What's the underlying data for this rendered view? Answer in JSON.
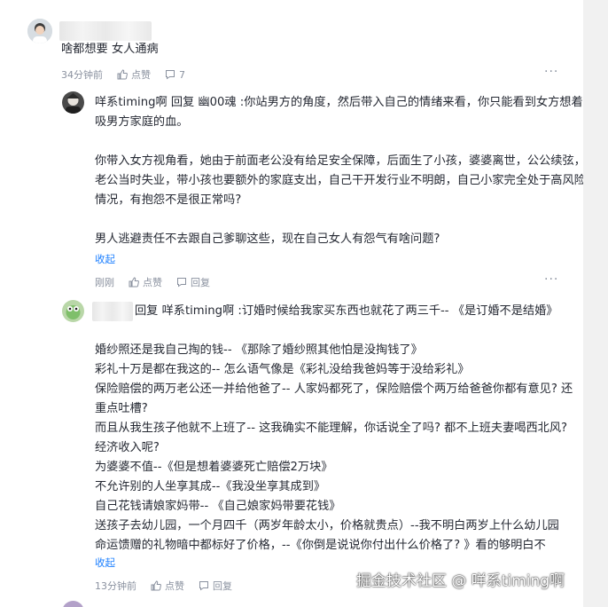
{
  "comment": {
    "text": "啥都想要 女人通病",
    "time": "34分钟前",
    "like_label": "点赞",
    "reply_count": "7",
    "more": "···"
  },
  "reply1": {
    "author": "咩系timing啊",
    "reply_word": "回复",
    "target": "幽00魂",
    "quote_line1": ":你站男方的角度，然后带入自己的情绪来看，你只能看到女方想着",
    "quote_line2": "吸男方家庭的血。",
    "para1_line1": "你带入女方视角看，她由于前面老公没有给足安全保障，后面生了小孩，婆婆离世，公公续弦，",
    "para1_line2": "老公当时失业，带小孩也要额外的家庭支出，自己干开发行业不明朗，自己小家完全处于高风险",
    "para1_line3": "情况，有抱怨不是很正常吗?",
    "para2": "男人逃避责任不去跟自己爹聊这些，现在自己女人有怨气有啥问题?",
    "collapse": "收起",
    "time": "刚刚",
    "like_label": "点赞",
    "reply_label": "回复",
    "more": "···"
  },
  "reply2": {
    "reply_word": "回复",
    "target": "咩系timing啊",
    "quote": ":订婚时候给我家买东西也就花了两三千-- 《是订婚不是结婚》",
    "lines": [
      "婚纱照还是我自己掏的钱-- 《那除了婚纱照其他怕是没掏钱了》",
      "彩礼十万是都在我这的-- 怎么语气像是《彩礼没给我爸妈等于没给彩礼》",
      "保险赔偿的两万老公还一并给他爸了-- 人家妈都死了，保险赔偿个两万给爸爸你都有意见? 还",
      "重点吐槽?",
      "而且从我生孩子他就不上班了-- 这我确实不能理解，你话说全了吗? 都不上班夫妻喝西北风?",
      "经济收入呢?",
      "为婆婆不值--《但是想着婆婆死亡赔偿2万块》",
      "不允许别的人坐享其成--《我没坐享其成到》",
      "自己花钱请娘家妈带-- 《自己娘家妈带要花钱》",
      "送孩子去幼儿园，一个月四千（两岁年龄太小，价格就贵点）--我不明白两岁上什么幼儿园",
      "命运馈赠的礼物暗中都标好了价格，--《你倒是说说你付出什么价格了? 》看的够明白不"
    ],
    "collapse": "收起",
    "time": "13分钟前",
    "like_label": "点赞",
    "reply_label": "回复"
  },
  "watermark": "掘金技术社区 @ 咩系timing啊"
}
